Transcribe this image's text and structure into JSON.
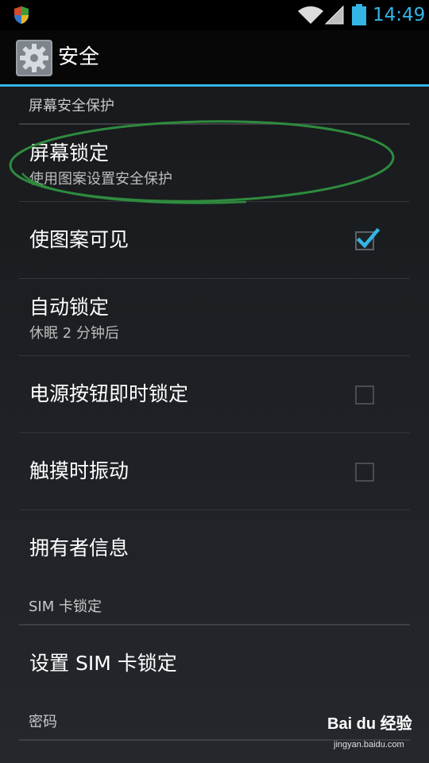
{
  "status_bar": {
    "time": "14:49",
    "icons": [
      "shield-icon",
      "wifi-icon",
      "signal-icon",
      "battery-icon"
    ],
    "accent_color": "#33b5e5"
  },
  "action_bar": {
    "title": "安全",
    "icon": "settings-gear-icon"
  },
  "sections": [
    {
      "header": "屏幕安全保护",
      "items": [
        {
          "title": "屏幕锁定",
          "subtitle": "使用图案设置安全保护",
          "highlighted": true
        },
        {
          "title": "使图案可见",
          "checked": true
        },
        {
          "title": "自动锁定",
          "subtitle": "休眠 2 分钟后"
        },
        {
          "title": "电源按钮即时锁定",
          "checked": false
        },
        {
          "title": "触摸时振动",
          "checked": false
        },
        {
          "title": "拥有者信息"
        }
      ]
    },
    {
      "header": "SIM 卡锁定",
      "items": [
        {
          "title": "设置 SIM 卡锁定"
        }
      ]
    },
    {
      "header": "密码",
      "items": []
    }
  ],
  "annotation": {
    "color": "#2e8b3e",
    "shape": "ellipse"
  },
  "watermark": {
    "brand": "Bai du 经验",
    "url": "jingyan.baidu.com"
  }
}
